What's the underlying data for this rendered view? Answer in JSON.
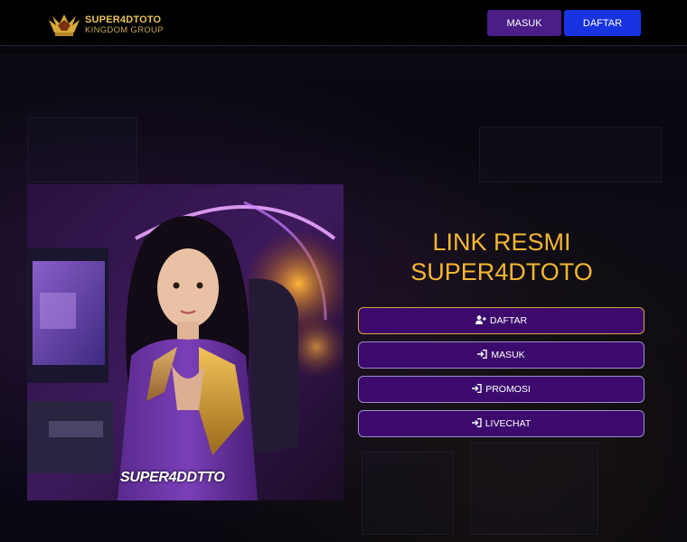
{
  "brand": {
    "line1": "SUPER4DTOTO",
    "line2": "KINGDOM GROUP"
  },
  "header": {
    "masuk_label": "MASUK",
    "daftar_label": "DAFTAR"
  },
  "hero": {
    "image_caption": "SUPER4DDTTO"
  },
  "title": {
    "line1": "LINK RESMI",
    "line2": "SUPER4DTOTO"
  },
  "menu": [
    {
      "label": "DAFTAR",
      "icon": "user-plus-icon"
    },
    {
      "label": "MASUK",
      "icon": "sign-in-icon"
    },
    {
      "label": "PROMOSI",
      "icon": "sign-in-icon"
    },
    {
      "label": "LIVECHAT",
      "icon": "sign-in-icon"
    }
  ],
  "colors": {
    "title": "#f5b731",
    "button_bg": "#3b0a6c",
    "header_daftar": "#1833e0",
    "header_masuk": "#4b1d86"
  }
}
